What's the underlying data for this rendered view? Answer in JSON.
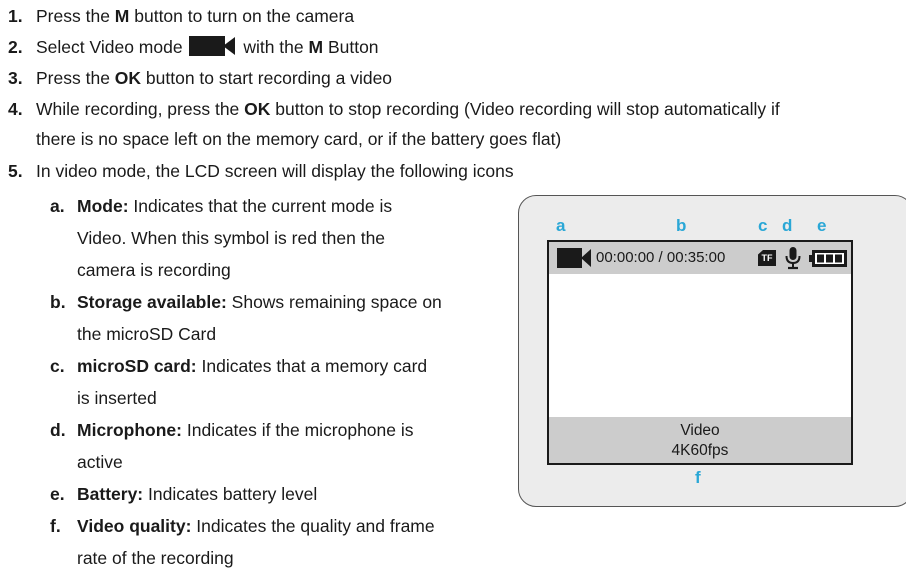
{
  "steps": [
    {
      "num": "1.",
      "parts": [
        {
          "t": "Press the "
        },
        {
          "b": "M"
        },
        {
          "t": " button to turn on the camera"
        }
      ]
    },
    {
      "num": "2.",
      "parts": [
        {
          "t": "Select Video mode "
        },
        {
          "icon": "video-camera-icon"
        },
        {
          "t": " with the "
        },
        {
          "b": "M"
        },
        {
          "t": " Button"
        }
      ]
    },
    {
      "num": "3.",
      "parts": [
        {
          "t": "Press the "
        },
        {
          "b": "OK"
        },
        {
          "t": " button to start recording a video"
        }
      ]
    },
    {
      "num": "4.",
      "parts": [
        {
          "t": "While recording, press the "
        },
        {
          "b": "OK"
        },
        {
          "t": " button to stop recording (Video recording will stop automatically if"
        }
      ],
      "continuation": "there is no space left on the memory card, or if the battery goes flat)"
    },
    {
      "num": "5.",
      "parts": [
        {
          "t": "In video mode, the LCD screen will display the following icons"
        }
      ]
    }
  ],
  "icons_list": [
    {
      "letter": "a.",
      "label": "Mode:",
      "lines": [
        " Indicates that the current mode is",
        "Video. When this symbol is red then the",
        "camera is recording"
      ]
    },
    {
      "letter": "b.",
      "label": "Storage available:",
      "lines": [
        " Shows remaining space on",
        "the microSD Card"
      ]
    },
    {
      "letter": "c.",
      "label": "microSD card:",
      "lines": [
        " Indicates that a memory card",
        "is inserted"
      ]
    },
    {
      "letter": "d.",
      "label": "Microphone:",
      "lines": [
        " Indicates if the microphone is",
        "active"
      ]
    },
    {
      "letter": "e.",
      "label": "Battery:",
      "lines": [
        " Indicates battery level"
      ]
    },
    {
      "letter": "f.",
      "label": "Video quality:",
      "lines": [
        " Indicates the quality and frame",
        "rate of the recording"
      ]
    }
  ],
  "diagram": {
    "callouts": {
      "a": "a",
      "b": "b",
      "c": "c",
      "d": "d",
      "e": "e",
      "f": "f"
    },
    "status_time": "00:00:00 / 00:35:00",
    "tf_label": "TF",
    "mode_label": "Video",
    "quality_label": "4K60fps",
    "icons": [
      "video-camera-icon",
      "microsd-card-icon",
      "microphone-icon",
      "battery-icon"
    ]
  },
  "colors": {
    "callout": "#2aa7d6",
    "text": "#1a1a1a",
    "bar": "#cccccc",
    "device": "#ececec"
  }
}
